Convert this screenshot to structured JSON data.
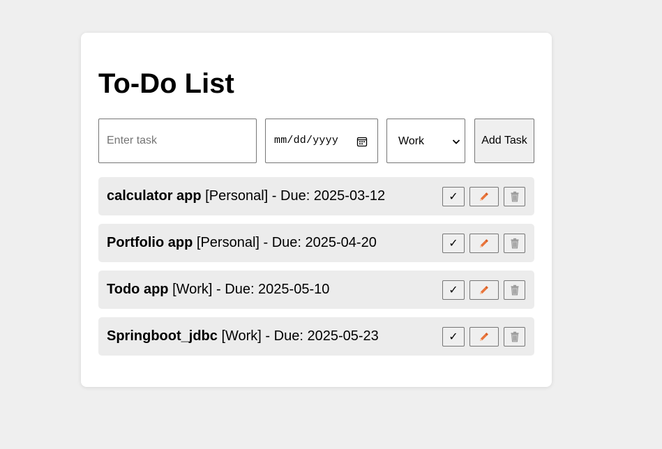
{
  "page": {
    "title": "To-Do List"
  },
  "form": {
    "task_placeholder": "Enter task",
    "date_placeholder": "mm/dd/yyyy",
    "category_selected": "Work",
    "add_button_label": "Add Task"
  },
  "tasks": [
    {
      "name": "calculator app",
      "category": "[Personal]",
      "due": " - Due: 2025-03-12"
    },
    {
      "name": "Portfolio app",
      "category": "[Personal]",
      "due": " - Due: 2025-04-20"
    },
    {
      "name": "Todo app",
      "category": "[Work]",
      "due": " - Due: 2025-05-10"
    },
    {
      "name": "Springboot_jdbc",
      "category": "[Work]",
      "due": " - Due: 2025-05-23"
    }
  ],
  "actions": {
    "complete_symbol": "✓",
    "complete_icon": "checkmark-icon",
    "edit_icon": "pencil-icon",
    "delete_icon": "trash-icon"
  },
  "colors": {
    "background": "#efefef",
    "card": "#ffffff",
    "task_row": "#ececec",
    "pencil": "#e8743b",
    "trash": "#9a9a9a"
  }
}
